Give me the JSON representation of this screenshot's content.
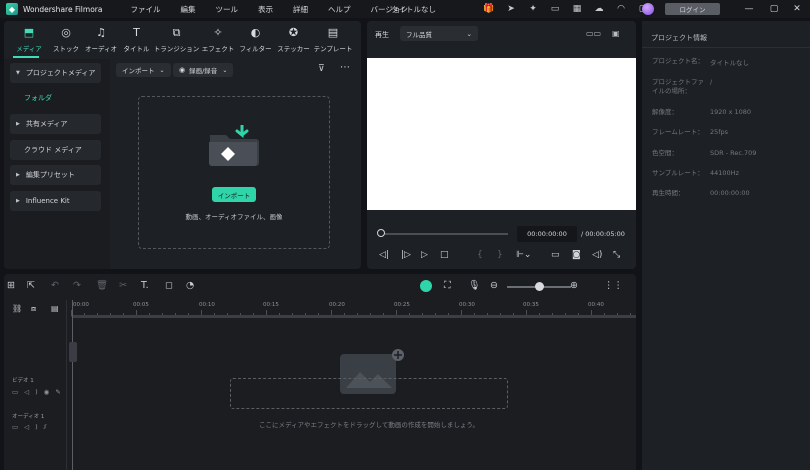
{
  "app": {
    "name": "Wondershare Filmora",
    "document_title": "タイトルなし",
    "login_label": "ログイン",
    "menus": [
      "ファイル",
      "編集",
      "ツール",
      "表示",
      "詳細",
      "ヘルプ",
      "バージョン"
    ]
  },
  "media_tabs": [
    {
      "label": "メディア",
      "icon": "media-icon",
      "glyph": "⬒",
      "active": true
    },
    {
      "label": "ストック",
      "icon": "stock-icon",
      "glyph": "◎"
    },
    {
      "label": "オーディオ",
      "icon": "audio-icon",
      "glyph": "♫"
    },
    {
      "label": "タイトル",
      "icon": "title-icon",
      "glyph": "T"
    },
    {
      "label": "トランジション",
      "icon": "transition-icon",
      "glyph": "⧉"
    },
    {
      "label": "エフェクト",
      "icon": "effect-icon",
      "glyph": "✧"
    },
    {
      "label": "フィルター",
      "icon": "filter-icon",
      "glyph": "◐"
    },
    {
      "label": "ステッカー",
      "icon": "sticker-icon",
      "glyph": "✪"
    },
    {
      "label": "テンプレート",
      "icon": "template-icon",
      "glyph": "▤"
    }
  ],
  "sidebar": {
    "project_media": "プロジェクトメディア",
    "folder": "フォルダ",
    "shared_media": "共有メディア",
    "cloud_media": "クラウド メディア",
    "edit_presets": "編集プリセット",
    "influence_kit": "Influence Kit"
  },
  "media_toolbar": {
    "import_label": "インポート",
    "record_label": "録画/録音"
  },
  "dropzone": {
    "import_button": "インポート",
    "hint": "動画、オーディオファイル、画像"
  },
  "player": {
    "label": "再生",
    "quality": "フル品質",
    "current_time": "00:00:00:00",
    "total_time": "/ 00:00:05:00"
  },
  "project_info": {
    "title": "プロジェクト情報",
    "rows": [
      {
        "key": "プロジェクト名：",
        "value": "タイトルなし"
      },
      {
        "key": "プロジェクトファイルの場所：",
        "value": "/"
      },
      {
        "key": "解像度：",
        "value": "1920 x 1080"
      },
      {
        "key": "フレームレート：",
        "value": "25fps"
      },
      {
        "key": "色空間：",
        "value": "SDR - Rec.709"
      },
      {
        "key": "サンプルレート：",
        "value": "44100Hz"
      },
      {
        "key": "再生時間：",
        "value": "00:00:00:00"
      }
    ]
  },
  "timeline": {
    "ruler_labels": [
      "00:00",
      "00:05",
      "00:10",
      "00:15",
      "00:20",
      "00:25",
      "00:30",
      "00:35",
      "00:40"
    ],
    "video_track": "ビデオ 1",
    "audio_track": "オーディオ 1",
    "drop_hint": "ここにメディアやエフェクトをドラッグして動画の作成を開始しましょう。"
  },
  "colors": {
    "accent": "#2fd4a8",
    "background": "#111318",
    "panel": "#1d2024"
  }
}
